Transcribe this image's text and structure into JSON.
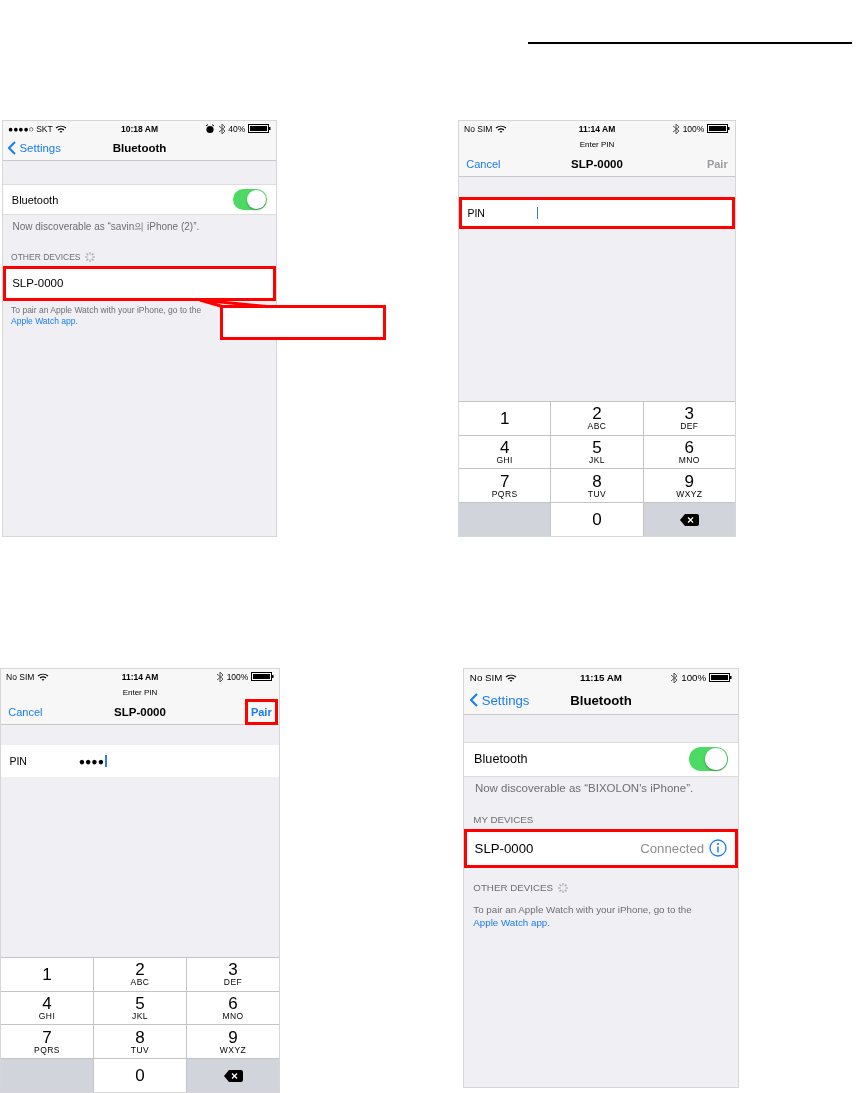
{
  "screens": [
    {
      "kind": "settings",
      "status": {
        "carrier": "●●●●○ SKT",
        "time": "10:18 AM",
        "battery": "40%",
        "alarm": true
      },
      "nav": {
        "back": "Settings",
        "title": "Bluetooth"
      },
      "toggle": {
        "label": "Bluetooth",
        "on": true
      },
      "note": "Now discoverable as “savin의 iPhone (2)”.",
      "sections": [
        {
          "header": "OTHER DEVICES",
          "searching": true,
          "devices": [
            {
              "name": "SLP-0000",
              "highlighted": true
            }
          ]
        }
      ],
      "footer": {
        "text": "To pair an Apple Watch with your iPhone, go to the",
        "link": "Apple Watch app."
      }
    },
    {
      "kind": "pin",
      "status": {
        "carrier": "No SIM",
        "time": "11:14 AM",
        "battery": "100%"
      },
      "prompt": "Enter PIN",
      "cancel": "Cancel",
      "title": "SLP-0000",
      "pair": {
        "label": "Pair",
        "disabled": true,
        "highlighted": false
      },
      "field": {
        "label": "PIN",
        "highlighted": true
      },
      "keys": [
        {
          "kind": "digit",
          "digit": "1"
        },
        {
          "kind": "digit",
          "digit": "2",
          "letters": "ABC"
        },
        {
          "kind": "digit",
          "digit": "3",
          "letters": "DEF"
        },
        {
          "kind": "digit",
          "digit": "4",
          "letters": "GHI"
        },
        {
          "kind": "digit",
          "digit": "5",
          "letters": "JKL"
        },
        {
          "kind": "digit",
          "digit": "6",
          "letters": "MNO"
        },
        {
          "kind": "digit",
          "digit": "7",
          "letters": "PQRS"
        },
        {
          "kind": "digit",
          "digit": "8",
          "letters": "TUV"
        },
        {
          "kind": "digit",
          "digit": "9",
          "letters": "WXYZ"
        },
        {
          "kind": "blank"
        },
        {
          "kind": "digit",
          "digit": "0"
        },
        {
          "kind": "delete"
        }
      ]
    },
    {
      "kind": "pin",
      "status": {
        "carrier": "No SIM",
        "time": "11:14 AM",
        "battery": "100%"
      },
      "prompt": "Enter PIN",
      "cancel": "Cancel",
      "title": "SLP-0000",
      "pair": {
        "label": "Pair",
        "disabled": false,
        "highlighted": true
      },
      "field": {
        "label": "PIN",
        "value": "●●●●",
        "highlighted": false
      },
      "keys": [
        {
          "kind": "digit",
          "digit": "1"
        },
        {
          "kind": "digit",
          "digit": "2",
          "letters": "ABC"
        },
        {
          "kind": "digit",
          "digit": "3",
          "letters": "DEF"
        },
        {
          "kind": "digit",
          "digit": "4",
          "letters": "GHI"
        },
        {
          "kind": "digit",
          "digit": "5",
          "letters": "JKL"
        },
        {
          "kind": "digit",
          "digit": "6",
          "letters": "MNO"
        },
        {
          "kind": "digit",
          "digit": "7",
          "letters": "PQRS"
        },
        {
          "kind": "digit",
          "digit": "8",
          "letters": "TUV"
        },
        {
          "kind": "digit",
          "digit": "9",
          "letters": "WXYZ"
        },
        {
          "kind": "blank"
        },
        {
          "kind": "digit",
          "digit": "0"
        },
        {
          "kind": "delete"
        }
      ]
    },
    {
      "kind": "settings",
      "status": {
        "carrier": "No SIM",
        "time": "11:15 AM",
        "battery": "100%"
      },
      "nav": {
        "back": "Settings",
        "title": "Bluetooth"
      },
      "toggle": {
        "label": "Bluetooth",
        "on": true
      },
      "note": "Now discoverable as “BIXOLON's iPhone”.",
      "sections": [
        {
          "header": "MY DEVICES",
          "devices": [
            {
              "name": "SLP-0000",
              "status": "Connected",
              "highlighted": true
            }
          ]
        },
        {
          "header": "OTHER DEVICES",
          "searching": true
        }
      ],
      "footer": {
        "text": "To pair an Apple Watch with your iPhone, go to the",
        "link": "Apple Watch app."
      }
    }
  ]
}
